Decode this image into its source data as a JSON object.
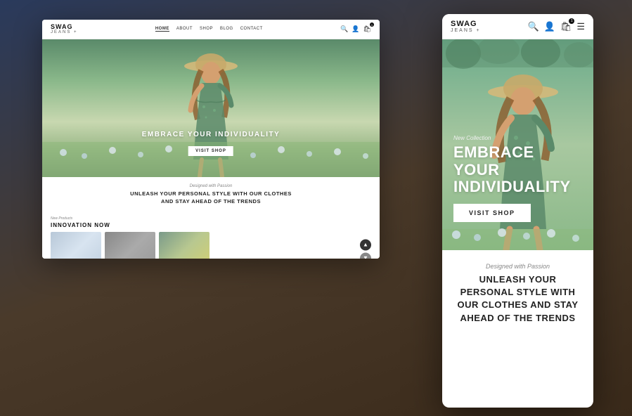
{
  "brand": {
    "name": "SWAG",
    "sub": "JEANS +",
    "plus": "+"
  },
  "desktop": {
    "nav": {
      "items": [
        "HOME",
        "ABOUT",
        "SHOP",
        "BLOG",
        "CONTACT"
      ],
      "active": "HOME"
    },
    "hero": {
      "tagline": "EMBRACE YOUR INDIVIDUALITY",
      "cta": "VISIT SHOP"
    },
    "section": {
      "subtitle": "Designed with Passion",
      "headline_line1": "UNLEASH YOUR PERSONAL STYLE WITH OUR CLOTHES",
      "headline_line2": "AND STAY AHEAD OF THE TRENDS"
    },
    "products": {
      "label": "New Products",
      "title": "INNOVATION NOW"
    }
  },
  "mobile": {
    "hero": {
      "tag": "New Collection",
      "title_line1": "EMBRACE YOUR",
      "title_line2": "INDIVIDUALITY",
      "cta": "VISIT SHOP"
    },
    "section": {
      "subtitle": "Designed with Passion",
      "headline_line1": "UNLEASH YOUR",
      "headline_line2": "PERSONAL STYLE WITH",
      "headline_line3": "OUR CLOTHES AND STAY",
      "headline_line4": "AHEAD OF THE TRENDS"
    }
  },
  "cart_count": "1",
  "icons": {
    "search": "🔍",
    "user": "👤",
    "cart": "🛒",
    "menu": "☰",
    "chevron_up": "▲",
    "chevron_down": "▼"
  }
}
